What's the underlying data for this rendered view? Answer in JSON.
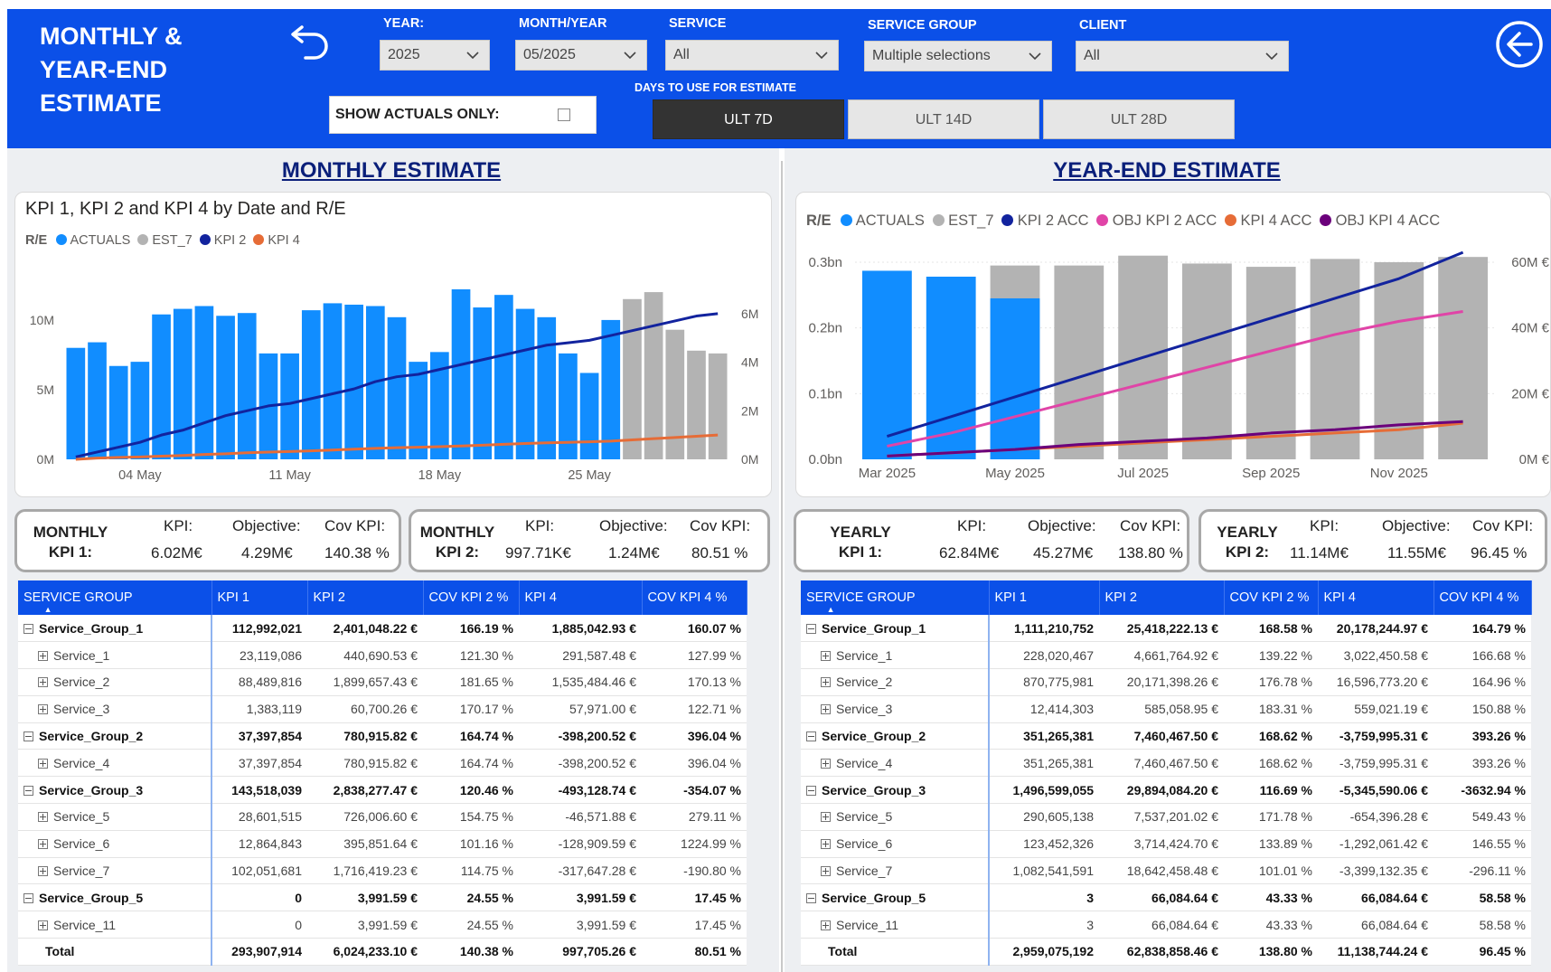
{
  "header": {
    "title_lines": [
      "MONTHLY &",
      "YEAR-END",
      "ESTIMATE"
    ],
    "filters": {
      "year": {
        "label": "YEAR:",
        "value": "2025"
      },
      "month_year": {
        "label": "MONTH/YEAR",
        "value": "05/2025"
      },
      "service": {
        "label": "SERVICE",
        "value": "All"
      },
      "service_group": {
        "label": "SERVICE GROUP",
        "value": "Multiple selections"
      },
      "client": {
        "label": "CLIENT",
        "value": "All"
      }
    },
    "show_actuals_label": "SHOW ACTUALS ONLY:",
    "days_label": "DAYS TO USE FOR ESTIMATE",
    "days_options": [
      "ULT 7D",
      "ULT 14D",
      "ULT 28D"
    ],
    "days_selected": "ULT 7D",
    "icons": [
      "undo-icon",
      "back-arrow-circle-icon",
      "chevron-down-icon"
    ],
    "colors": {
      "header_bg": "#0b50e8"
    }
  },
  "monthly": {
    "section_title": "MONTHLY ESTIMATE",
    "chart_title": "KPI 1, KPI 2 and KPI 4 by Date and R/E",
    "legend_title": "R/E",
    "legend": [
      {
        "name": "ACTUALS",
        "color": "#118dff"
      },
      {
        "name": "EST_7",
        "color": "#b3b3b3"
      },
      {
        "name": "KPI 2",
        "color": "#12239e"
      },
      {
        "name": "KPI 4",
        "color": "#e66c37"
      }
    ],
    "kpi1": {
      "label": "MONTHLY KPI 1:",
      "kpi_header": "KPI:",
      "obj_header": "Objective:",
      "cov_header": "Cov KPI:",
      "kpi": "6.02M€",
      "objective": "4.29M€",
      "cov": "140.38 %"
    },
    "kpi2": {
      "label": "MONTHLY KPI 2:",
      "kpi_header": "KPI:",
      "obj_header": "Objective:",
      "cov_header": "Cov KPI:",
      "kpi": "997.71K€",
      "objective": "1.24M€",
      "cov": "80.51 %"
    },
    "table": {
      "headers": [
        "SERVICE GROUP",
        "KPI 1",
        "KPI 2",
        "COV KPI 2 %",
        "KPI 4",
        "COV KPI 4 %"
      ],
      "rows": [
        {
          "type": "grp",
          "cells": [
            "Service_Group_1",
            "112,992,021",
            "2,401,048.22 €",
            "166.19 %",
            "1,885,042.93 €",
            "160.07 %"
          ]
        },
        {
          "type": "svc",
          "cells": [
            "Service_1",
            "23,119,086",
            "440,690.53 €",
            "121.30 %",
            "291,587.48 €",
            "127.99 %"
          ]
        },
        {
          "type": "svc",
          "cells": [
            "Service_2",
            "88,489,816",
            "1,899,657.43 €",
            "181.65 %",
            "1,535,484.46 €",
            "170.13 %"
          ]
        },
        {
          "type": "svc",
          "cells": [
            "Service_3",
            "1,383,119",
            "60,700.26 €",
            "170.17 %",
            "57,971.00 €",
            "122.71 %"
          ]
        },
        {
          "type": "grp",
          "cells": [
            "Service_Group_2",
            "37,397,854",
            "780,915.82 €",
            "164.74 %",
            "-398,200.52 €",
            "396.04 %"
          ]
        },
        {
          "type": "svc",
          "cells": [
            "Service_4",
            "37,397,854",
            "780,915.82 €",
            "164.74 %",
            "-398,200.52 €",
            "396.04 %"
          ]
        },
        {
          "type": "grp",
          "cells": [
            "Service_Group_3",
            "143,518,039",
            "2,838,277.47 €",
            "120.46 %",
            "-493,128.74 €",
            "-354.07 %"
          ]
        },
        {
          "type": "svc",
          "cells": [
            "Service_5",
            "28,601,515",
            "726,006.60 €",
            "154.75 %",
            "-46,571.88 €",
            "279.11 %"
          ]
        },
        {
          "type": "svc",
          "cells": [
            "Service_6",
            "12,864,843",
            "395,851.64 €",
            "101.16 %",
            "-128,909.59 €",
            "1224.99 %"
          ]
        },
        {
          "type": "svc",
          "cells": [
            "Service_7",
            "102,051,681",
            "1,716,419.23 €",
            "114.75 %",
            "-317,647.28 €",
            "-190.80 %"
          ]
        },
        {
          "type": "grp",
          "cells": [
            "Service_Group_5",
            "0",
            "3,991.59 €",
            "24.55 %",
            "3,991.59 €",
            "17.45 %"
          ]
        },
        {
          "type": "svc",
          "cells": [
            "Service_11",
            "0",
            "3,991.59 €",
            "24.55 %",
            "3,991.59 €",
            "17.45 %"
          ]
        },
        {
          "type": "tot",
          "cells": [
            "Total",
            "293,907,914",
            "6,024,233.10 €",
            "140.38 %",
            "997,705.26 €",
            "80.51 %"
          ]
        }
      ]
    }
  },
  "yearly": {
    "section_title": "YEAR-END ESTIMATE",
    "legend_title": "R/E",
    "legend": [
      {
        "name": "ACTUALS",
        "color": "#118dff"
      },
      {
        "name": "EST_7",
        "color": "#b3b3b3"
      },
      {
        "name": "KPI 2 ACC",
        "color": "#12239e"
      },
      {
        "name": "OBJ KPI 2 ACC",
        "color": "#e044a7"
      },
      {
        "name": "KPI 4 ACC",
        "color": "#e66c37"
      },
      {
        "name": "OBJ KPI 4 ACC",
        "color": "#6b007b"
      }
    ],
    "kpi1": {
      "label": "YEARLY KPI 1:",
      "kpi_header": "KPI:",
      "obj_header": "Objective:",
      "cov_header": "Cov KPI:",
      "kpi": "62.84M€",
      "objective": "45.27M€",
      "cov": "138.80 %"
    },
    "kpi2": {
      "label": "YEARLY KPI 2:",
      "kpi_header": "KPI:",
      "obj_header": "Objective:",
      "cov_header": "Cov KPI:",
      "kpi": "11.14M€",
      "objective": "11.55M€",
      "cov": "96.45 %"
    },
    "table": {
      "headers": [
        "SERVICE GROUP",
        "KPI 1",
        "KPI 2",
        "COV KPI 2 %",
        "KPI 4",
        "COV KPI 4 %"
      ],
      "rows": [
        {
          "type": "grp",
          "cells": [
            "Service_Group_1",
            "1,111,210,752",
            "25,418,222.13 €",
            "168.58 %",
            "20,178,244.97 €",
            "164.79 %"
          ]
        },
        {
          "type": "svc",
          "cells": [
            "Service_1",
            "228,020,467",
            "4,661,764.92 €",
            "139.22 %",
            "3,022,450.58 €",
            "166.68 %"
          ]
        },
        {
          "type": "svc",
          "cells": [
            "Service_2",
            "870,775,981",
            "20,171,398.26 €",
            "176.78 %",
            "16,596,773.20 €",
            "164.96 %"
          ]
        },
        {
          "type": "svc",
          "cells": [
            "Service_3",
            "12,414,303",
            "585,058.95 €",
            "183.31 %",
            "559,021.19 €",
            "150.88 %"
          ]
        },
        {
          "type": "grp",
          "cells": [
            "Service_Group_2",
            "351,265,381",
            "7,460,467.50 €",
            "168.62 %",
            "-3,759,995.31 €",
            "393.26 %"
          ]
        },
        {
          "type": "svc",
          "cells": [
            "Service_4",
            "351,265,381",
            "7,460,467.50 €",
            "168.62 %",
            "-3,759,995.31 €",
            "393.26 %"
          ]
        },
        {
          "type": "grp",
          "cells": [
            "Service_Group_3",
            "1,496,599,055",
            "29,894,084.20 €",
            "116.69 %",
            "-5,345,590.06 €",
            "-3632.94 %"
          ]
        },
        {
          "type": "svc",
          "cells": [
            "Service_5",
            "290,605,138",
            "7,537,201.02 €",
            "171.78 %",
            "-654,396.28 €",
            "549.43 %"
          ]
        },
        {
          "type": "svc",
          "cells": [
            "Service_6",
            "123,452,326",
            "3,714,424.70 €",
            "133.89 %",
            "-1,292,061.42 €",
            "146.55 %"
          ]
        },
        {
          "type": "svc",
          "cells": [
            "Service_7",
            "1,082,541,591",
            "18,642,458.48 €",
            "101.01 %",
            "-3,399,132.35 €",
            "-296.11 %"
          ]
        },
        {
          "type": "grp",
          "cells": [
            "Service_Group_5",
            "3",
            "66,084.64 €",
            "43.33 %",
            "66,084.64 €",
            "58.58 %"
          ]
        },
        {
          "type": "svc",
          "cells": [
            "Service_11",
            "3",
            "66,084.64 €",
            "43.33 %",
            "66,084.64 €",
            "58.58 %"
          ]
        },
        {
          "type": "tot",
          "cells": [
            "Total",
            "2,959,075,192",
            "62,838,858.46 €",
            "138.80 %",
            "11,138,744.24 €",
            "96.45 %"
          ]
        }
      ]
    }
  },
  "chart_data": [
    {
      "type": "bar",
      "title": "KPI 1, KPI 2 and KPI 4 by Date and R/E",
      "legend_title": "R/E",
      "x_ticks": [
        "04 May",
        "11 May",
        "18 May",
        "25 May"
      ],
      "y_ticks_left": [
        "0M",
        "5M",
        "10M"
      ],
      "y_ticks_right": [
        "0M",
        "2M",
        "4M",
        "6M"
      ],
      "y_left_max": 12.2,
      "y_right_max": 7.0,
      "bar_series": [
        {
          "name": "ACTUALS",
          "values": [
            8.0,
            8.4,
            6.7,
            7.0,
            10.4,
            10.8,
            11.0,
            10.3,
            10.5,
            7.6,
            7.6,
            10.7,
            11.2,
            11.1,
            11.0,
            10.2,
            7.0,
            7.7,
            12.2,
            10.9,
            11.8,
            10.8,
            10.2,
            7.6,
            6.2,
            10.0,
            null,
            null,
            null,
            null,
            null
          ],
          "color": "#118dff"
        },
        {
          "name": "EST_7",
          "values": [
            null,
            null,
            null,
            null,
            null,
            null,
            null,
            null,
            null,
            null,
            null,
            null,
            null,
            null,
            null,
            null,
            null,
            null,
            null,
            null,
            null,
            null,
            null,
            null,
            null,
            null,
            11.5,
            12.0,
            9.3,
            7.8,
            7.6
          ],
          "color": "#b3b3b3"
        }
      ],
      "line_series": [
        {
          "name": "KPI 2",
          "axis": "right",
          "color": "#12239e",
          "values": [
            0.1,
            0.3,
            0.5,
            0.7,
            1.0,
            1.2,
            1.5,
            1.8,
            2.0,
            2.2,
            2.3,
            2.5,
            2.7,
            2.9,
            3.2,
            3.4,
            3.5,
            3.7,
            3.9,
            4.1,
            4.3,
            4.5,
            4.7,
            4.8,
            4.9,
            5.1,
            5.3,
            5.5,
            5.7,
            5.9,
            6.0
          ]
        },
        {
          "name": "KPI 4",
          "axis": "right",
          "color": "#e66c37",
          "values": [
            0.0,
            0.05,
            0.08,
            0.1,
            0.13,
            0.16,
            0.2,
            0.23,
            0.27,
            0.3,
            0.32,
            0.35,
            0.38,
            0.42,
            0.45,
            0.48,
            0.5,
            0.52,
            0.55,
            0.58,
            0.62,
            0.65,
            0.68,
            0.7,
            0.72,
            0.75,
            0.8,
            0.85,
            0.9,
            0.95,
            1.0
          ]
        }
      ]
    },
    {
      "type": "bar",
      "legend_title": "R/E",
      "x_ticks": [
        "Mar 2025",
        "May 2025",
        "Jul 2025",
        "Sep 2025",
        "Nov 2025"
      ],
      "y_ticks_left": [
        "0.0bn",
        "0.1bn",
        "0.2bn",
        "0.3bn"
      ],
      "y_ticks_right": [
        "0M €",
        "20M €",
        "40M €",
        "60M €"
      ],
      "y_left_max": 0.3,
      "y_right_max": 60,
      "categories": [
        "Mar 2025",
        "Apr 2025",
        "May 2025",
        "Jun 2025",
        "Jul 2025",
        "Aug 2025",
        "Sep 2025",
        "Oct 2025",
        "Nov 2025",
        "Dec 2025"
      ],
      "bar_series": [
        {
          "name": "ACTUALS",
          "values": [
            0.287,
            0.278,
            0.245,
            null,
            null,
            null,
            null,
            null,
            null,
            null
          ],
          "color": "#118dff"
        },
        {
          "name": "EST_7",
          "values": [
            null,
            null,
            0.295,
            0.295,
            0.31,
            0.298,
            0.293,
            0.305,
            0.3,
            0.308
          ],
          "color": "#b3b3b3"
        }
      ],
      "line_series": [
        {
          "name": "KPI 2 ACC",
          "axis": "right",
          "color": "#12239e",
          "values": [
            7,
            13,
            19,
            25,
            31,
            37,
            43,
            49,
            55,
            63
          ]
        },
        {
          "name": "OBJ KPI 2 ACC",
          "axis": "right",
          "color": "#e044a7",
          "values": [
            4,
            8,
            13,
            18,
            23,
            28,
            33,
            38,
            42,
            45
          ]
        },
        {
          "name": "KPI 4 ACC",
          "axis": "right",
          "color": "#e66c37",
          "values": [
            1,
            2,
            3,
            4,
            5,
            6,
            7,
            8,
            9,
            11
          ]
        },
        {
          "name": "OBJ KPI 4 ACC",
          "axis": "right",
          "color": "#6b007b",
          "values": [
            1,
            2,
            3,
            4.5,
            5.5,
            6.5,
            8,
            9,
            10.5,
            11.5
          ]
        }
      ]
    }
  ]
}
